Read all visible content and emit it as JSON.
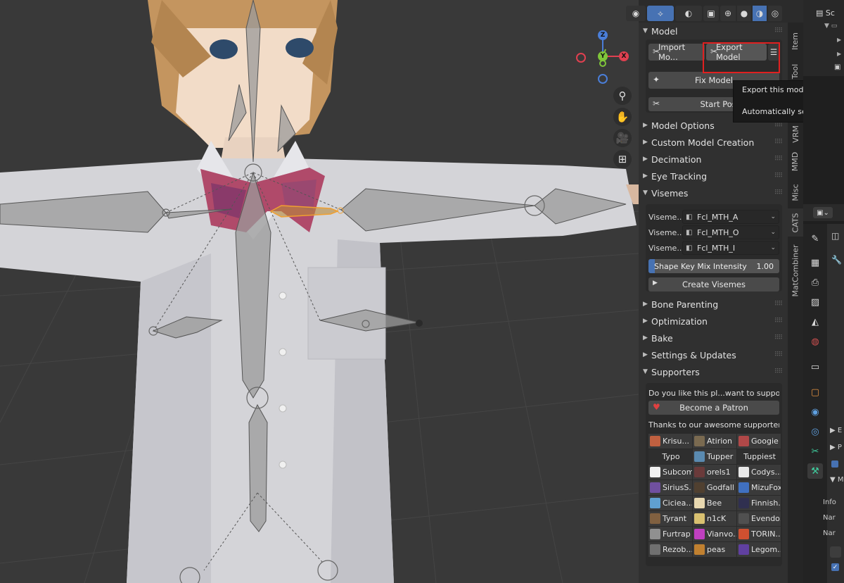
{
  "viewport": {
    "header_icons": [
      "visibility-icon",
      "gizmo-icon",
      "overlay-icon",
      "xray-icon",
      "wireframe-shading-icon",
      "solid-shading-icon",
      "material-shading-icon",
      "rendered-shading-icon"
    ],
    "gizmo": {
      "z": "Z",
      "y": "Y",
      "x": "X"
    },
    "nav_tools": [
      "zoom-icon",
      "hand-icon",
      "camera-icon",
      "grid-icon"
    ]
  },
  "panel": {
    "model": {
      "title": "Model",
      "import_label": "Import Mo...",
      "export_label": "Export Model",
      "fix_label": "Fix Model",
      "pose_label": "Start Pose Mo"
    },
    "collapsed_sections": [
      "Model Options",
      "Custom Model Creation",
      "Decimation",
      "Eye Tracking"
    ],
    "visemes": {
      "title": "Visemes",
      "rows": [
        {
          "label": "Viseme...",
          "value": "Fcl_MTH_A"
        },
        {
          "label": "Viseme...",
          "value": "Fcl_MTH_O"
        },
        {
          "label": "Viseme...",
          "value": "Fcl_MTH_I"
        }
      ],
      "slider_label": "Shape Key Mix Intensity",
      "slider_value": "1.00",
      "slider_fraction": 0.05,
      "create_label": "Create Visemes"
    },
    "more_sections": [
      "Bone Parenting",
      "Optimization",
      "Bake",
      "Settings & Updates"
    ],
    "supporters": {
      "title": "Supporters",
      "prompt": "Do you like this pl...want to support us",
      "patron_label": "Become a Patron",
      "thanks": "Thanks to our awesome supporters! ...",
      "cells": [
        {
          "name": "Krisu...",
          "color": "#c06040"
        },
        {
          "name": "Atirion",
          "color": "#7a6a50"
        },
        {
          "name": "Googie",
          "color": "#b04848"
        },
        {
          "name": "Typo",
          "color": ""
        },
        {
          "name": "Tupper",
          "color": "#5a8ab0"
        },
        {
          "name": "Tuppiest",
          "color": ""
        },
        {
          "name": "Subcom",
          "color": "#f0f0f0"
        },
        {
          "name": "orels1",
          "color": "#6a3a3a"
        },
        {
          "name": "Codys...",
          "color": "#e8e8e8"
        },
        {
          "name": "SiriusS...",
          "color": "#7050a0"
        },
        {
          "name": "Godfall",
          "color": "#504030"
        },
        {
          "name": "MizuFox",
          "color": "#4070c0"
        },
        {
          "name": "Ciciea...",
          "color": "#60a0d0"
        },
        {
          "name": "Bee",
          "color": "#e8d8b0"
        },
        {
          "name": "Finnish...",
          "color": "#303050"
        },
        {
          "name": "Tyrant",
          "color": "#806040"
        },
        {
          "name": "n1cK",
          "color": "#d8c070"
        },
        {
          "name": "Evendo...",
          "color": "#505050"
        },
        {
          "name": "Furtrap",
          "color": "#909090"
        },
        {
          "name": "Vianvo...",
          "color": "#c040c0"
        },
        {
          "name": "TORIN...",
          "color": "#d05030"
        },
        {
          "name": "Rezob...",
          "color": "#707070"
        },
        {
          "name": "peas",
          "color": "#c08030"
        },
        {
          "name": "Legom...",
          "color": "#6040a0"
        }
      ]
    }
  },
  "tabs": [
    "Item",
    "Tool",
    "VRM",
    "MMD",
    "Misc",
    "CATS",
    "MatCombiner"
  ],
  "tooltip": {
    "line1": "Export this model as .fbx for U",
    "line2": "Automatically sets the optima"
  },
  "right": {
    "outliner_rows": [
      "Sc",
      "",
      "",
      ""
    ],
    "props_labels": [
      "E",
      "P",
      "M",
      "Info",
      "Nar",
      "Nar"
    ]
  }
}
